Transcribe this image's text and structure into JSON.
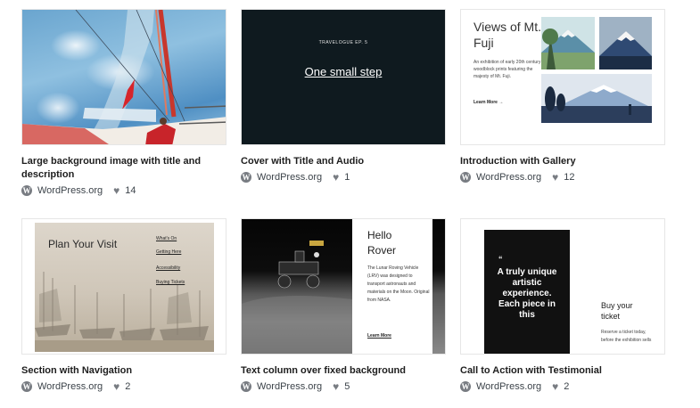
{
  "patterns": [
    {
      "title": "Large background image with title and description",
      "author": "WordPress.org",
      "likes": "14",
      "preview": {}
    },
    {
      "title": "Cover with Title and Audio",
      "author": "WordPress.org",
      "likes": "1",
      "preview": {
        "eyebrow": "TRAVELOGUE EP. 5",
        "heading": "One small step"
      }
    },
    {
      "title": "Introduction with Gallery",
      "author": "WordPress.org",
      "likes": "12",
      "preview": {
        "heading": "Views of Mt. Fuji",
        "description": "An exhibition of early 20th century woodblock prints featuring the majesty of Mt. Fuji.",
        "link": "Learn More →"
      }
    },
    {
      "title": "Section with Navigation",
      "author": "WordPress.org",
      "likes": "2",
      "preview": {
        "heading": "Plan Your Visit",
        "nav": [
          "What's On",
          "Getting Here",
          "Accessibility",
          "Buying Tickets"
        ]
      }
    },
    {
      "title": "Text column over fixed background",
      "author": "WordPress.org",
      "likes": "5",
      "preview": {
        "heading": "Hello Rover",
        "description": "The Lunar Roving Vehicle (LRV) was designed to transport astronauts and materials on the Moon. Original from NASA.",
        "link": "Learn More"
      }
    },
    {
      "title": "Call to Action with Testimonial",
      "author": "WordPress.org",
      "likes": "2",
      "preview": {
        "quote_mark": "“",
        "quote": "A truly unique artistic experience. Each piece in this",
        "heading": "Buy your ticket",
        "description": "Reserve a ticket today, before the exhibition sells"
      }
    }
  ],
  "colors": {
    "text": "#1e1e1e",
    "meta": "#50575e",
    "border": "#e6e6e6",
    "dark_cover": "#0f1a1f"
  },
  "icons": {
    "author": "wordpress-logo-icon",
    "likes": "heart-icon"
  }
}
